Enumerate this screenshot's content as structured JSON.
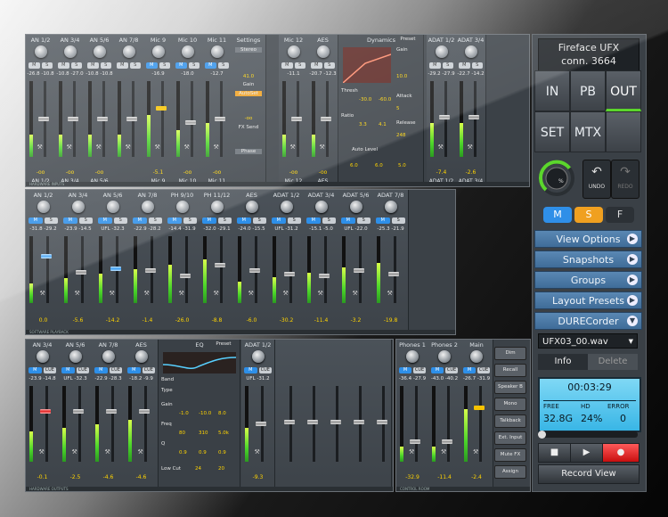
{
  "device": {
    "name": "Fireface  UFX",
    "connection": "conn.  3664"
  },
  "view_buttons": [
    "IN",
    "PB",
    "OUT",
    "SET",
    "MTX"
  ],
  "undo": {
    "undo_label": "UNDO",
    "redo_label": "REDO"
  },
  "msf_buttons": {
    "m": "M",
    "s": "S",
    "f": "F"
  },
  "menu": {
    "view_options": "View Options",
    "snapshots": "Snapshots",
    "groups": "Groups",
    "layout_presets": "Layout Presets",
    "durecorder": "DURECorder"
  },
  "recorder": {
    "file": "UFX03_00.wav",
    "tab_info": "Info",
    "tab_delete": "Delete",
    "time": "00:03:29",
    "free_label": "FREE",
    "hd_label": "HD",
    "error_label": "ERROR",
    "free_value": "32.8G",
    "hd_value": "24%",
    "error_value": "0",
    "record_view": "Record View"
  },
  "hardware_inputs": [
    {
      "name": "AN 1/2",
      "peak": "-26.8  -10.8",
      "gain": "-oo",
      "bottom": "AN 1/2"
    },
    {
      "name": "AN 3/4",
      "peak": "-10.8  -27.0",
      "gain": "-oo",
      "bottom": "AN 3/4"
    },
    {
      "name": "AN 5/6",
      "peak": "-10.8  -10.8",
      "gain": "-oo",
      "bottom": "AN 5/6"
    },
    {
      "name": "AN 7/8",
      "peak": "",
      "gain": "",
      "bottom": ""
    },
    {
      "name": "Mic 9",
      "peak": "-16.9",
      "gain": "-5.1",
      "bottom": "Mic 9"
    },
    {
      "name": "Mic 10",
      "peak": "-18.0",
      "gain": "-oo",
      "bottom": "Mic 10"
    },
    {
      "name": "Mic 11",
      "peak": "-12.7",
      "gain": "-oo",
      "bottom": "Mic 11"
    }
  ],
  "settings_panel": {
    "title": "Settings",
    "stereo": "Stereo",
    "gain_value": "41.0",
    "gain_label": "Gain",
    "autoset": "AutoSet",
    "fx_send_value": "-oo",
    "fx_send_label": "FX Send",
    "phase": "Phase"
  },
  "hardware_inputs_2": [
    {
      "name": "Mic 12",
      "peak": "-11.1",
      "gain": "-oo",
      "bottom": "Mic 12"
    },
    {
      "name": "AES",
      "peak": "-20.7  -12.3",
      "gain": "-oo",
      "bottom": "AES"
    }
  ],
  "dynamics": {
    "title": "Dynamics",
    "preset": "Preset",
    "gain_label": "Gain",
    "gain_value": "10.0",
    "thresh_label": "Thresh",
    "thresh_value": "-30.0",
    "thresh_value2": "-60.0",
    "attack_label": "Attack",
    "attack_value": "5",
    "ratio_label": "Ratio",
    "ratio_value": "3.3",
    "ratio_value2": "4.1",
    "release_value": "248",
    "release_label": "Release",
    "auto_level": "Auto Level",
    "max_gain": "6.0",
    "headroom": "6.0",
    "rise_time": "5.0"
  },
  "hardware_inputs_3": [
    {
      "name": "ADAT 1/2",
      "peak": "-29.2  -27.9",
      "gain": "-7.4",
      "bottom": "ADAT 1/2"
    },
    {
      "name": "ADAT 3/4",
      "peak": "-22.7  -14.2",
      "gain": "-2.6",
      "bottom": "ADAT 3/4"
    }
  ],
  "software_playback": [
    {
      "name": "AN 1/2",
      "peak": "-31.8  -29.2",
      "gain": "0.0"
    },
    {
      "name": "AN 3/4",
      "peak": "-23.9  -14.5",
      "gain": "-5.6"
    },
    {
      "name": "AN 5/6",
      "peak": "UFL  -32.3",
      "gain": "-14.2"
    },
    {
      "name": "AN 7/8",
      "peak": "-22.9  -28.2",
      "gain": "-1.4"
    },
    {
      "name": "PH 9/10",
      "peak": "-14.4  -31.9",
      "gain": "-26.0"
    },
    {
      "name": "PH 11/12",
      "peak": "-32.0  -29.1",
      "gain": "-8.8"
    },
    {
      "name": "AES",
      "peak": "-24.0  -15.5",
      "gain": "-6.0"
    },
    {
      "name": "ADAT 1/2",
      "peak": "UFL  -31.2",
      "gain": "-30.2"
    },
    {
      "name": "ADAT 3/4",
      "peak": "-15.1  -5.0",
      "gain": "-11.4"
    },
    {
      "name": "ADAT 5/6",
      "peak": "UFL  -22.0",
      "gain": "-3.2"
    },
    {
      "name": "ADAT 7/8",
      "peak": "-25.3  -21.9",
      "gain": "-19.8"
    }
  ],
  "hardware_outputs": [
    {
      "name": "AN 3/4",
      "peak": "-23.9  -14.8",
      "gain": "-0.1"
    },
    {
      "name": "AN 5/6",
      "peak": "UFL  -32.3",
      "gain": "-2.5"
    },
    {
      "name": "AN 7/8",
      "peak": "-22.9  -28.3",
      "gain": "-4.6"
    },
    {
      "name": "AES",
      "peak": "-18.2  -9.9",
      "gain": "-4.6"
    }
  ],
  "eq": {
    "title": "EQ",
    "preset": "Preset",
    "band_label": "Band",
    "type_label": "Type",
    "gain_label": "Gain",
    "freq_label": "Freq",
    "q_label": "Q",
    "gains": [
      "-1.0",
      "-10.0",
      "8.0"
    ],
    "freqs": [
      "80",
      "310",
      "5.0k"
    ],
    "qs": [
      "0.9",
      "0.9",
      "0.9"
    ],
    "low_cut": "Low Cut",
    "lc_freq": "24",
    "lc_slope": "20"
  },
  "hardware_outputs_2": [
    {
      "name": "ADAT 1/2",
      "peak": "UFL  -31.2",
      "gain": "-9.3"
    }
  ],
  "control_room": [
    {
      "name": "Phones 1",
      "peak": "-36.4  -27.9",
      "gain": "-32.9"
    },
    {
      "name": "Phones 2",
      "peak": "-43.0  -40.2",
      "gain": "-11.4"
    },
    {
      "name": "Main",
      "peak": "-26.7  -31.9",
      "gain": "-2.4"
    }
  ],
  "control_buttons": [
    "Dim",
    "Recall",
    "Speaker B",
    "Mono",
    "Talkback",
    "Ext. Input",
    "Mute FX",
    "Assign"
  ],
  "sections": {
    "hw_inputs": "HARDWARE INPUTS",
    "sw_playback": "SOFTWARE PLAYBACK",
    "hw_outputs": "HARDWARE OUTPUTS",
    "control_room": "CONTROL ROOM"
  }
}
